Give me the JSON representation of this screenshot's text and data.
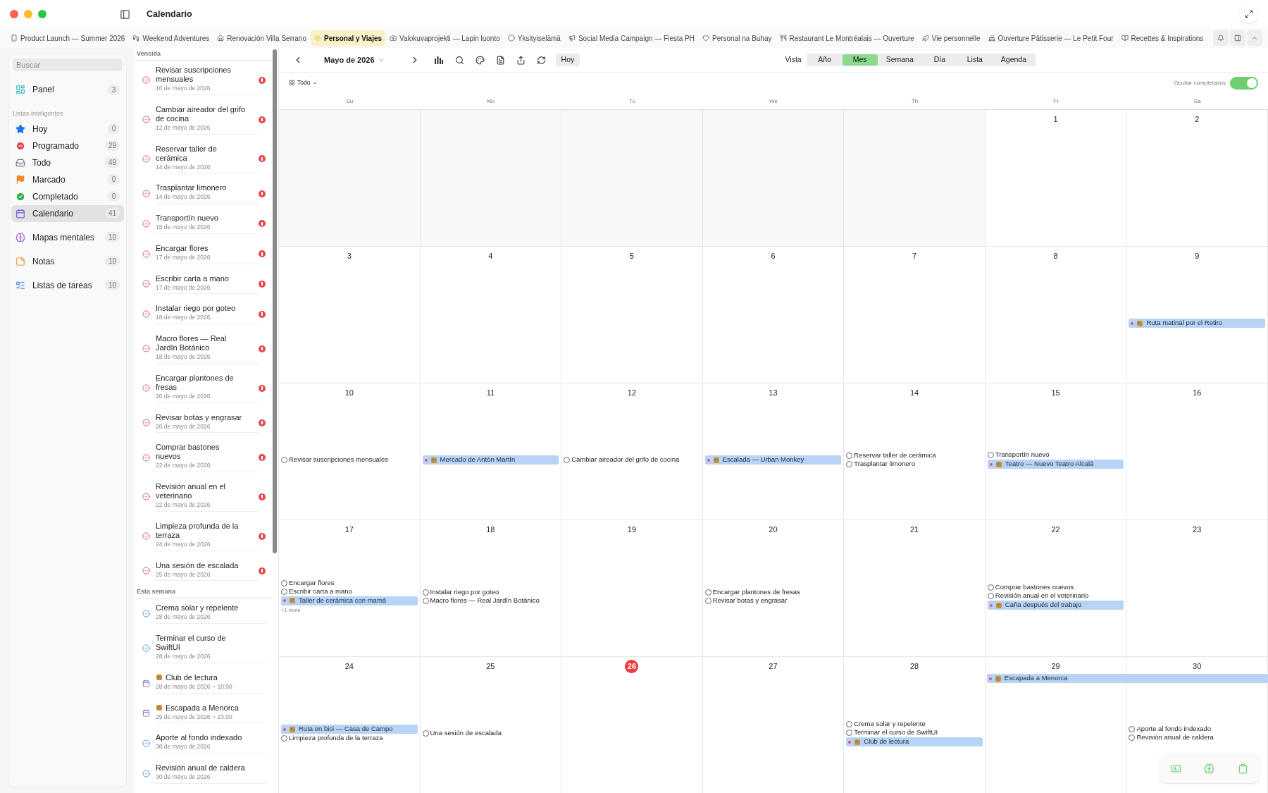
{
  "window": {
    "title": "Calendario"
  },
  "project_tabs": [
    {
      "label": "Product Launch — Summer 2026",
      "selected": false
    },
    {
      "label": "Weekend Adventures",
      "selected": false
    },
    {
      "label": "Renovación Villa Serrano",
      "selected": false
    },
    {
      "label": "Personal y Viajes",
      "selected": true
    },
    {
      "label": "Valokuvaprojekti — Lapin luonto",
      "selected": false
    },
    {
      "label": "Yksityiselämä",
      "selected": false
    },
    {
      "label": "Social Media Campaign — Fiesta PH",
      "selected": false
    },
    {
      "label": "Personal na Buhay",
      "selected": false
    },
    {
      "label": "Restaurant Le Montréalais — Ouverture",
      "selected": false
    },
    {
      "label": "Vie personnelle",
      "selected": false
    },
    {
      "label": "Ouverture Pâtisserie — Le Petit Four",
      "selected": false
    },
    {
      "label": "Recettes & Inspirations",
      "selected": false
    }
  ],
  "sidebar": {
    "search": {
      "placeholder": "Buscar"
    },
    "top_items": [
      {
        "label": "Panel",
        "count": "3",
        "selected": false
      }
    ],
    "section_title": "Listas inteligentes",
    "smart_lists": [
      {
        "label": "Hoy",
        "count": "0",
        "selected": false
      },
      {
        "label": "Programado",
        "count": "29",
        "selected": false
      },
      {
        "label": "Todo",
        "count": "49",
        "selected": false
      },
      {
        "label": "Marcado",
        "count": "0",
        "selected": false
      },
      {
        "label": "Completado",
        "count": "0",
        "selected": false
      },
      {
        "label": "Calendario",
        "count": "41",
        "selected": true
      }
    ],
    "bottom_items": [
      {
        "label": "Mapas mentales",
        "count": "10",
        "selected": false
      },
      {
        "label": "Notas",
        "count": "10",
        "selected": false
      },
      {
        "label": "Listas de tareas",
        "count": "10",
        "selected": false
      }
    ]
  },
  "task_list": {
    "sections": [
      {
        "title": "Vencida",
        "items": [
          {
            "kind": "task",
            "title": "Revisar suscripciones mensuales",
            "date": "10 de mayo de 2026",
            "overdue": true
          },
          {
            "kind": "task",
            "title": "Cambiar aireador del grifo de cocina",
            "date": "12 de mayo de 2026",
            "overdue": true
          },
          {
            "kind": "task",
            "title": "Reservar taller de cerámica",
            "date": "14 de mayo de 2026",
            "overdue": true
          },
          {
            "kind": "task",
            "title": "Trasplantar limonero",
            "date": "14 de mayo de 2026",
            "overdue": true
          },
          {
            "kind": "task",
            "title": "Transportín nuevo",
            "date": "15 de mayo de 2026",
            "overdue": true
          },
          {
            "kind": "task",
            "title": "Encargar flores",
            "date": "17 de mayo de 2026",
            "overdue": true
          },
          {
            "kind": "task",
            "title": "Escribir carta a mano",
            "date": "17 de mayo de 2026",
            "overdue": true
          },
          {
            "kind": "task",
            "title": "Instalar riego por goteo",
            "date": "18 de mayo de 2026",
            "overdue": true
          },
          {
            "kind": "task",
            "title": "Macro flores — Real Jardín Botánico",
            "date": "18 de mayo de 2026",
            "overdue": true
          },
          {
            "kind": "task",
            "title": "Encargar plantones de fresas",
            "date": "20 de mayo de 2026",
            "overdue": true
          },
          {
            "kind": "task",
            "title": "Revisar botas y engrasar",
            "date": "20 de mayo de 2026",
            "overdue": true
          },
          {
            "kind": "task",
            "title": "Comprar bastones nuevos",
            "date": "22 de mayo de 2026",
            "overdue": true
          },
          {
            "kind": "task",
            "title": "Revisión anual en el veterinario",
            "date": "22 de mayo de 2026",
            "overdue": true
          },
          {
            "kind": "task",
            "title": "Limpieza profunda de la terraza",
            "date": "24 de mayo de 2026",
            "overdue": true
          },
          {
            "kind": "task",
            "title": "Una sesión de escalada",
            "date": "25 de mayo de 2026",
            "overdue": true
          }
        ]
      },
      {
        "title": "Esta semana",
        "items": [
          {
            "kind": "task",
            "title": "Crema solar y repelente",
            "date": "28 de mayo de 2026",
            "overdue": false
          },
          {
            "kind": "task",
            "title": "Terminar el curso de SwiftUI",
            "date": "28 de mayo de 2026",
            "overdue": false
          },
          {
            "kind": "event",
            "title": "Club de lectura",
            "date": "28 de mayo de 2026",
            "time": "10:00"
          },
          {
            "kind": "event",
            "title": "Escapada a Menorca",
            "date": "29 de mayo de 2026",
            "time": "23:00"
          },
          {
            "kind": "task",
            "title": "Aporte al fondo indexado",
            "date": "30 de mayo de 2026",
            "overdue": false
          },
          {
            "kind": "task",
            "title": "Revisión anual de caldera",
            "date": "30 de mayo de 2026",
            "overdue": false
          }
        ]
      }
    ]
  },
  "toolbar": {
    "month": "Mayo de 2026",
    "today_button": "Hoy",
    "view_label": "Vista",
    "views": [
      {
        "label": "Año",
        "selected": false
      },
      {
        "label": "Mes",
        "selected": true
      },
      {
        "label": "Semana",
        "selected": false
      },
      {
        "label": "Día",
        "selected": false
      },
      {
        "label": "Lista",
        "selected": false
      },
      {
        "label": "Agenda",
        "selected": false
      }
    ],
    "filter": "Todo",
    "hide_completed": {
      "label": "Ocultar completados",
      "on": true
    }
  },
  "calendar": {
    "weekdays": [
      "Su",
      "Mo",
      "Tu",
      "We",
      "Th",
      "Fr",
      "Sa"
    ],
    "weeks": [
      {
        "days": [
          {
            "kind": "blank"
          },
          {
            "kind": "blank"
          },
          {
            "kind": "blank"
          },
          {
            "kind": "blank"
          },
          {
            "kind": "blank"
          },
          {
            "date": "1"
          },
          {
            "date": "2"
          }
        ]
      },
      {
        "days": [
          {
            "date": "3"
          },
          {
            "date": "4"
          },
          {
            "date": "5"
          },
          {
            "date": "6"
          },
          {
            "date": "7"
          },
          {
            "date": "8"
          },
          {
            "date": "9",
            "items": [
              {
                "kind": "event",
                "title": "Ruta matinal por el Retiro"
              }
            ]
          }
        ]
      },
      {
        "days": [
          {
            "date": "10",
            "items": [
              {
                "kind": "task",
                "title": "Revisar suscripciones mensuales",
                "checked": false
              }
            ]
          },
          {
            "date": "11",
            "items": [
              {
                "kind": "event",
                "title": "Mercado de Antón Martín"
              }
            ]
          },
          {
            "date": "12",
            "items": [
              {
                "kind": "task",
                "title": "Cambiar aireador del grifo de cocina",
                "checked": false
              }
            ]
          },
          {
            "date": "13",
            "items": [
              {
                "kind": "event",
                "title": "Escalada — Urban Monkey"
              }
            ]
          },
          {
            "date": "14",
            "items": [
              {
                "kind": "task",
                "title": "Reservar taller de cerámica",
                "checked": false
              },
              {
                "kind": "task",
                "title": "Trasplantar limonero",
                "checked": false
              }
            ]
          },
          {
            "date": "15",
            "items": [
              {
                "kind": "task",
                "title": "Transportín nuevo",
                "checked": false
              },
              {
                "kind": "event",
                "title": "Teatro — Nuevo Teatro Alcalá"
              }
            ]
          },
          {
            "date": "16"
          }
        ]
      },
      {
        "days": [
          {
            "date": "17",
            "items": [
              {
                "kind": "task",
                "title": "Encargar flores",
                "checked": false
              },
              {
                "kind": "task",
                "title": "Escribir carta a mano",
                "checked": false
              },
              {
                "kind": "event",
                "title": "Taller de cerámica con mamá"
              }
            ],
            "more": "+1 more"
          },
          {
            "date": "18",
            "items": [
              {
                "kind": "task",
                "title": "Instalar riego por goteo",
                "checked": false
              },
              {
                "kind": "task",
                "title": "Macro flores — Real Jardín Botánico",
                "checked": false
              }
            ]
          },
          {
            "date": "19"
          },
          {
            "date": "20",
            "items": [
              {
                "kind": "task",
                "title": "Encargar plantones de fresas",
                "checked": false
              },
              {
                "kind": "task",
                "title": "Revisar botas y engrasar",
                "checked": false
              }
            ]
          },
          {
            "date": "21"
          },
          {
            "date": "22",
            "items": [
              {
                "kind": "task",
                "title": "Comprar bastones nuevos",
                "checked": false
              },
              {
                "kind": "task",
                "title": "Revisión anual en el veterinario",
                "checked": false
              },
              {
                "kind": "event",
                "title": "Caña después del trabajo"
              }
            ]
          },
          {
            "date": "23"
          }
        ]
      },
      {
        "days": [
          {
            "date": "24",
            "items": [
              {
                "kind": "event",
                "title": "Ruta en bici — Casa de Campo"
              },
              {
                "kind": "task",
                "title": "Limpieza profunda de la terraza",
                "checked": false
              }
            ]
          },
          {
            "date": "25",
            "items": [
              {
                "kind": "task",
                "title": "Una sesión de escalada",
                "checked": false
              }
            ]
          },
          {
            "date": "26",
            "today": true
          },
          {
            "date": "27"
          },
          {
            "date": "28",
            "items": [
              {
                "kind": "task",
                "title": "Crema solar y repelente",
                "checked": false
              },
              {
                "kind": "task",
                "title": "Terminar el curso de SwiftUI",
                "checked": false
              },
              {
                "kind": "event",
                "title": "Club de lectura"
              }
            ]
          },
          {
            "date": "29",
            "items": [
              {
                "kind": "span_event",
                "title": "Escapada a Menorca"
              }
            ]
          },
          {
            "date": "30",
            "items": [
              {
                "kind": "task",
                "title": "Aporte al fondo indexado",
                "checked": false
              },
              {
                "kind": "task",
                "title": "Revisión anual de caldera",
                "checked": false
              }
            ]
          }
        ]
      }
    ]
  }
}
